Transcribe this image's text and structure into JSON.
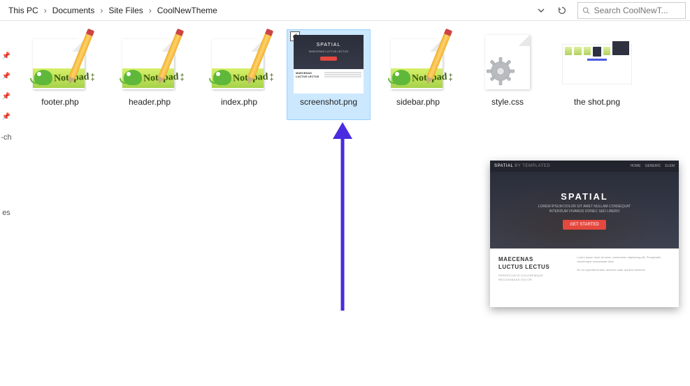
{
  "breadcrumb": [
    "This PC",
    "Documents",
    "Site Files",
    "CoolNewTheme"
  ],
  "search": {
    "placeholder": "Search CoolNewT..."
  },
  "files": [
    {
      "name": "footer.php",
      "kind": "npp"
    },
    {
      "name": "header.php",
      "kind": "npp"
    },
    {
      "name": "index.php",
      "kind": "npp"
    },
    {
      "name": "screenshot.png",
      "kind": "shot",
      "selected": true
    },
    {
      "name": "sidebar.php",
      "kind": "npp"
    },
    {
      "name": "style.css",
      "kind": "css"
    },
    {
      "name": "the shot.png",
      "kind": "shot2"
    }
  ],
  "sidebar_truncated": [
    "",
    "",
    "",
    "",
    "-ch",
    "",
    "es"
  ],
  "preview": {
    "brand": "SPATIAL",
    "brand_suffix": "BY TEMPLATED",
    "nav_links": [
      "HOME",
      "GENERIC",
      "ELEM"
    ],
    "hero_title": "SPATIAL",
    "hero_subtitle_1": "LOREM IPSUM DOLOR SIT AMET NULLAM CONSEQUAT",
    "hero_subtitle_2": "INTERDUM VIVAMUS DONEC SED LIBERO",
    "cta": "GET STARTED",
    "section_title_1": "MAECENAS",
    "section_title_2": "LUCTUS LECTUS",
    "section_sub_1": "PERSPICIATIS DOLOREMQUE",
    "section_sub_2": "RECUSANDAE DOLOR",
    "para_1": "Lorem ipsum dolor sit amet, consectetur adipisicing elit. Perspiciatis doloremque recusandae dolor",
    "para_2": "Illo ex expedita tenetur dolorem nulla, quidem deserunt"
  },
  "thumb": {
    "title": "SPATIAL",
    "sub": "MAECENAS LUCTUS LECTUS"
  },
  "npp_text": "Notepad"
}
